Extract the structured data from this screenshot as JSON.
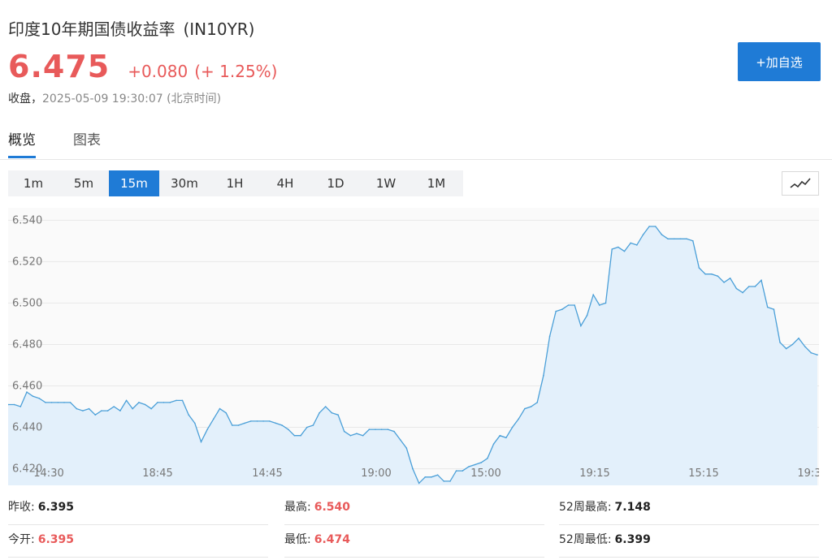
{
  "header": {
    "title": "印度10年期国债收益率",
    "code": "(IN10YR)",
    "price": "6.475",
    "change": "+0.080",
    "change_pct": "(+ 1.25%)",
    "status_label": "收盘，",
    "timestamp": "2025-05-09 19:30:07",
    "timezone": "(北京时间)",
    "add_button": "+加自选"
  },
  "tabs": [
    {
      "label": "概览",
      "active": true
    },
    {
      "label": "图表",
      "active": false
    }
  ],
  "intervals": [
    {
      "label": "1m",
      "active": false
    },
    {
      "label": "5m",
      "active": false
    },
    {
      "label": "15m",
      "active": true
    },
    {
      "label": "30m",
      "active": false
    },
    {
      "label": "1H",
      "active": false
    },
    {
      "label": "4H",
      "active": false
    },
    {
      "label": "1D",
      "active": false
    },
    {
      "label": "1W",
      "active": false
    },
    {
      "label": "1M",
      "active": false
    }
  ],
  "chart_type_icon": "line-chart-icon",
  "colors": {
    "accent": "#1f7bd6",
    "up": "#e85a5a",
    "line": "#4a9fd8",
    "area": "#e3f0fb"
  },
  "chart_data": {
    "type": "area",
    "ylim": [
      6.412,
      6.546
    ],
    "yticks": [
      "6.540",
      "6.520",
      "6.500",
      "6.480",
      "6.460",
      "6.440",
      "6.420"
    ],
    "xticks": [
      "14:30",
      "18:45",
      "14:45",
      "19:00",
      "15:00",
      "19:15",
      "15:15",
      "19:3"
    ],
    "grid": true,
    "values": [
      6.451,
      6.451,
      6.45,
      6.457,
      6.455,
      6.454,
      6.452,
      6.452,
      6.452,
      6.452,
      6.452,
      6.449,
      6.448,
      6.449,
      6.446,
      6.448,
      6.448,
      6.45,
      6.448,
      6.453,
      6.449,
      6.452,
      6.451,
      6.449,
      6.452,
      6.452,
      6.452,
      6.453,
      6.453,
      6.446,
      6.442,
      6.433,
      6.439,
      6.444,
      6.449,
      6.447,
      6.441,
      6.441,
      6.442,
      6.443,
      6.443,
      6.443,
      6.443,
      6.442,
      6.441,
      6.439,
      6.436,
      6.436,
      6.44,
      6.441,
      6.447,
      6.45,
      6.447,
      6.446,
      6.438,
      6.436,
      6.437,
      6.436,
      6.439,
      6.439,
      6.439,
      6.439,
      6.438,
      6.434,
      6.43,
      6.42,
      6.413,
      6.416,
      6.416,
      6.417,
      6.414,
      6.414,
      6.419,
      6.419,
      6.421,
      6.422,
      6.423,
      6.425,
      6.432,
      6.436,
      6.435,
      6.44,
      6.444,
      6.449,
      6.45,
      6.452,
      6.465,
      6.484,
      6.496,
      6.497,
      6.499,
      6.499,
      6.489,
      6.494,
      6.504,
      6.499,
      6.5,
      6.526,
      6.527,
      6.525,
      6.529,
      6.528,
      6.533,
      6.537,
      6.537,
      6.533,
      6.531,
      6.531,
      6.531,
      6.531,
      6.53,
      6.517,
      6.514,
      6.514,
      6.513,
      6.51,
      6.512,
      6.507,
      6.505,
      6.508,
      6.508,
      6.511,
      6.498,
      6.497,
      6.481,
      6.478,
      6.48,
      6.483,
      6.479,
      6.476,
      6.475
    ]
  },
  "stats": [
    {
      "label": "昨收:",
      "value": "6.395",
      "tone": "dark"
    },
    {
      "label": "最高:",
      "value": "6.540",
      "tone": "red"
    },
    {
      "label": "52周最高:",
      "value": "7.148",
      "tone": "dark"
    },
    {
      "label": "今开:",
      "value": "6.395",
      "tone": "red"
    },
    {
      "label": "最低:",
      "value": "6.474",
      "tone": "red"
    },
    {
      "label": "52周最低:",
      "value": "6.399",
      "tone": "dark"
    }
  ]
}
